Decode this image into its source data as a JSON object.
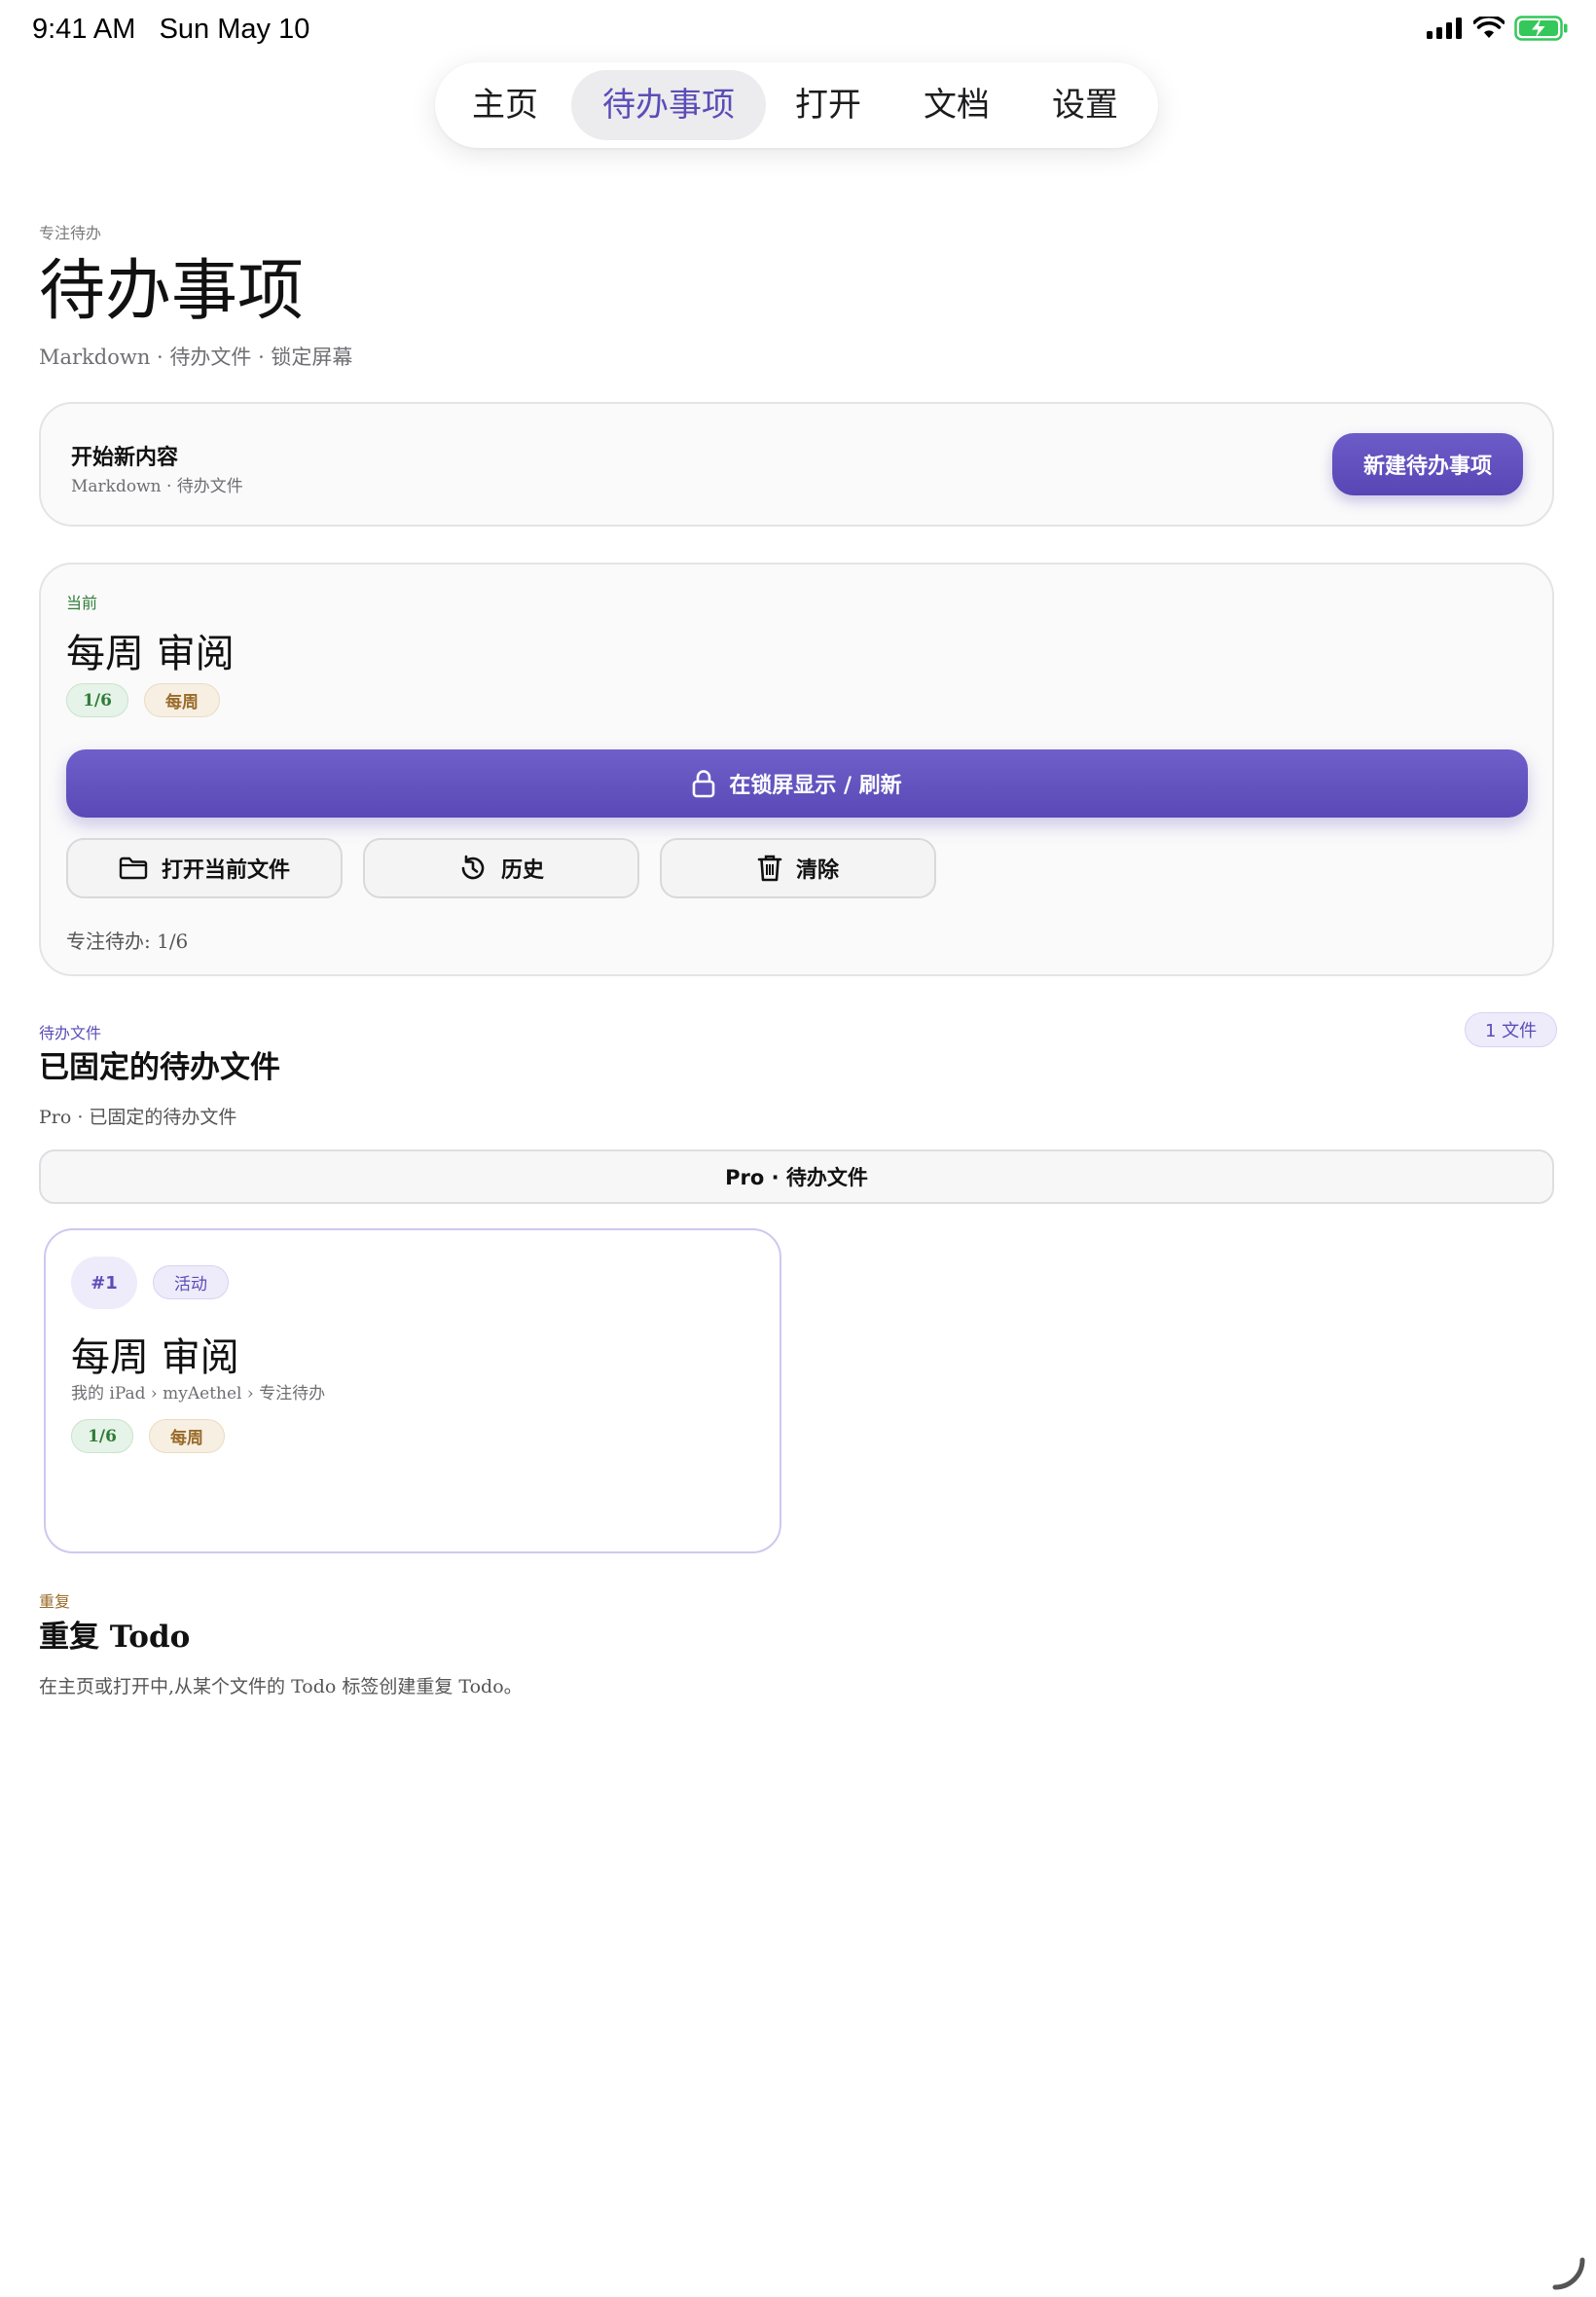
{
  "status_bar": {
    "time": "9:41 AM",
    "date": "Sun May 10",
    "icons": [
      "cellular-signal-icon",
      "wifi-icon",
      "battery-charging-icon"
    ]
  },
  "nav": {
    "tabs": [
      {
        "label": "主页",
        "active": false
      },
      {
        "label": "待办事项",
        "active": true
      },
      {
        "label": "打开",
        "active": false
      },
      {
        "label": "文档",
        "active": false
      },
      {
        "label": "设置",
        "active": false
      }
    ]
  },
  "header": {
    "eyebrow": "专注待办",
    "title": "待办事项",
    "subtitle": "Markdown · 待办文件 · 锁定屏幕"
  },
  "start_card": {
    "title": "开始新内容",
    "subtitle": "Markdown · 待办文件",
    "button": "新建待办事项"
  },
  "current_card": {
    "label": "当前",
    "title": "每周 审阅",
    "progress_chip": "1/6",
    "recurrence_chip": "每周",
    "lock_button": "在锁屏显示 / 刷新",
    "actions": {
      "open": "打开当前文件",
      "history": "历史",
      "clear": "清除"
    },
    "focus_line": "专注待办: 1/6"
  },
  "pinned": {
    "label": "待办文件",
    "title": "已固定的待办文件",
    "subtitle": "Pro · 已固定的待办文件",
    "count_badge": "1 文件",
    "pro_bar": "Pro · 待办文件",
    "files": [
      {
        "number": "#1",
        "status": "活动",
        "title": "每周 审阅",
        "path": "我的 iPad › myAethel › 专注待办",
        "progress": "1/6",
        "recurrence": "每周"
      }
    ]
  },
  "repeat": {
    "label": "重复",
    "title": "重复 Todo",
    "description": "在主页或打开中,从某个文件的 Todo 标签创建重复 Todo。"
  },
  "colors": {
    "accent": "#5b4db8",
    "green": "#2f7d3a",
    "gold": "#9a6a2a"
  }
}
